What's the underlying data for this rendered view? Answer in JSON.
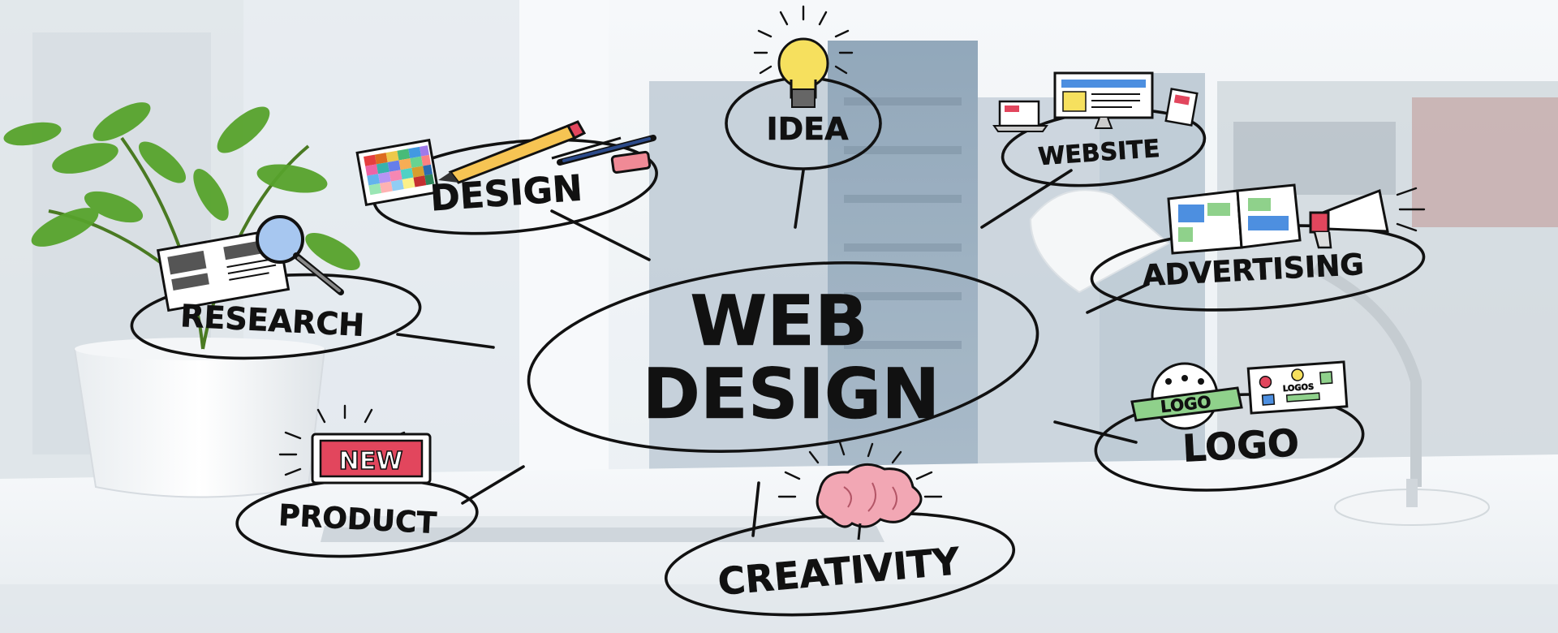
{
  "central": {
    "line1": "WEB",
    "line2": "DESIGN"
  },
  "nodes": {
    "idea": "IDEA",
    "design": "DESIGN",
    "website": "WEBSITE",
    "research": "RESEARCH",
    "advertising": "ADVERTISING",
    "logo": "LOGO",
    "product": "PRODUCT",
    "creativity": "CREATIVITY"
  },
  "badges": {
    "new": "NEW",
    "logo_ribbon": "LOGO",
    "logos_sheet": "LOGOS"
  },
  "colors": {
    "sky": "#dfe8ee",
    "building": "#6f8aa0",
    "desk": "#f4f6f8",
    "plant": "#4f9a2a",
    "ink": "#111111",
    "brain": "#f2a7b4",
    "new_badge": "#e2465d",
    "bulb": "#f6e05e",
    "ribbon": "#8fd18b",
    "screen_blue": "#4d8fe0"
  }
}
